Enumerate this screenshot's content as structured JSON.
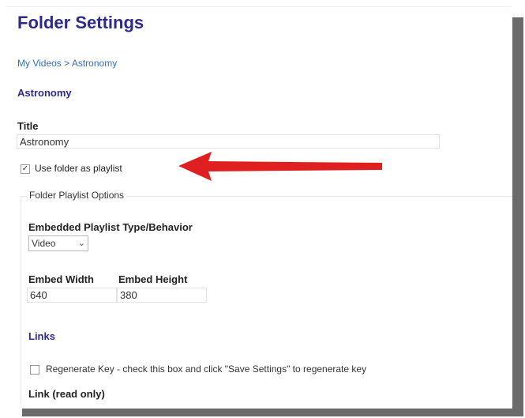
{
  "page": {
    "title": "Folder Settings",
    "breadcrumb": {
      "parent": "My Videos",
      "separator": ">",
      "current": "Astronomy"
    },
    "section_heading": "Astronomy"
  },
  "form": {
    "title_label": "Title",
    "title_value": "Astronomy",
    "use_folder_playlist": {
      "label": "Use folder as playlist",
      "checked": true
    },
    "playlist_options": {
      "legend": "Folder Playlist Options",
      "embed_type_label": "Embedded Playlist Type/Behavior",
      "embed_type_value": "Video",
      "embed_width_label": "Embed Width",
      "embed_width_value": "640",
      "embed_height_label": "Embed Height",
      "embed_height_value": "380"
    },
    "links": {
      "heading": "Links",
      "regenerate_label": "Regenerate Key - check this box and click \"Save Settings\" to regenerate key",
      "regenerate_checked": false,
      "link_label": "Link (read only)"
    }
  },
  "colors": {
    "heading": "#2d2a8a",
    "link": "#3b6fb5",
    "annotation_arrow": "#e02020"
  },
  "icons": {
    "annotation": "red-arrow-left-icon",
    "dropdown": "chevron-down-icon",
    "check": "checkmark-icon"
  }
}
